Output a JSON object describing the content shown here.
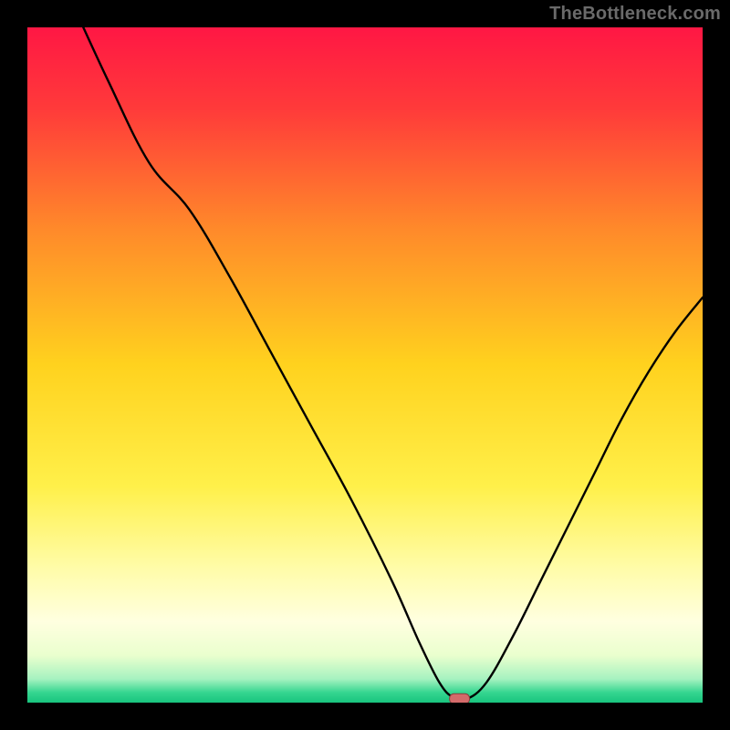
{
  "watermark": "TheBottleneck.com",
  "colors": {
    "frame": "#000000",
    "curve": "#000000",
    "marker_fill": "#d46a6a",
    "marker_stroke": "#8a3d3d",
    "gradient_stops": [
      {
        "offset": 0.0,
        "color": "#ff1744"
      },
      {
        "offset": 0.12,
        "color": "#ff3a3a"
      },
      {
        "offset": 0.3,
        "color": "#ff8a2a"
      },
      {
        "offset": 0.5,
        "color": "#ffd21e"
      },
      {
        "offset": 0.68,
        "color": "#fff04a"
      },
      {
        "offset": 0.8,
        "color": "#fffca8"
      },
      {
        "offset": 0.88,
        "color": "#ffffe0"
      },
      {
        "offset": 0.93,
        "color": "#eaffce"
      },
      {
        "offset": 0.965,
        "color": "#a6f2c0"
      },
      {
        "offset": 0.985,
        "color": "#35d690"
      },
      {
        "offset": 1.0,
        "color": "#18c47e"
      }
    ]
  },
  "chart_data": {
    "type": "line",
    "title": "",
    "xlabel": "",
    "ylabel": "",
    "xlim": [
      0,
      100
    ],
    "ylim": [
      0,
      100
    ],
    "x": [
      0,
      6,
      12,
      18,
      24,
      30,
      36,
      42,
      48,
      54,
      58,
      61,
      63,
      65,
      68,
      72,
      76,
      80,
      84,
      88,
      92,
      96,
      100
    ],
    "values": [
      118,
      105,
      92,
      80,
      73,
      63,
      52,
      41,
      30,
      18,
      9,
      3,
      0.8,
      0.5,
      3,
      10,
      18,
      26,
      34,
      42,
      49,
      55,
      60
    ],
    "marker": {
      "x": 64,
      "y": 0.5
    },
    "note": "x = relative position along horizontal axis (0–100, arbitrary units); values = curve height as % of plot height (0 at bottom green band, 100 at top red). Curve starts off-canvas at top-left, has a pronounced slope change around x≈24, reaches a minimum near x≈64 (marker), then rises to ~60 at the right edge."
  }
}
